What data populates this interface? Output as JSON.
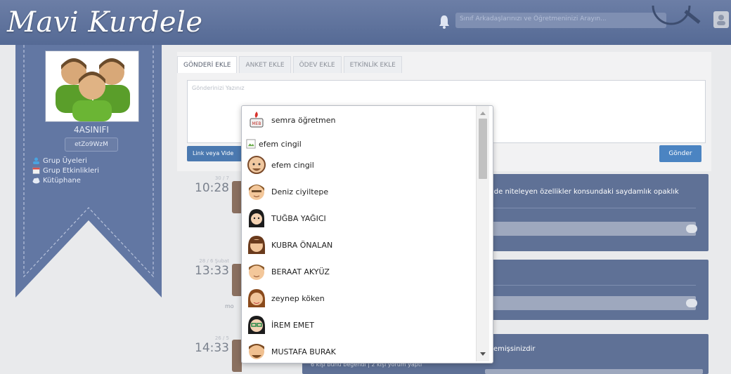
{
  "header": {
    "logo": "Mavi Kurdele",
    "search_placeholder": "Sınıf Arkadaşlarınızı ve Öğretmeninizi Arayın..."
  },
  "sidebar": {
    "group_name": "4ASINIFI",
    "group_code": "etZo9WzM",
    "menu": [
      {
        "label": "Grup Üyeleri",
        "icon": "users-icon"
      },
      {
        "label": "Grup Etkinlikleri",
        "icon": "calendar-icon"
      },
      {
        "label": "Kütüphane",
        "icon": "cloud-icon"
      }
    ]
  },
  "composer": {
    "tabs": [
      "GÖNDERİ EKLE",
      "ANKET EKLE",
      "ÖDEV EKLE",
      "ETKİNLİK EKLE"
    ],
    "placeholder": "Gönderinizi Yazınız",
    "link_button": "Link veya Vide",
    "send_button": "Gönder"
  },
  "feed": [
    {
      "date": "30 / 7",
      "time": "10:28",
      "text": "lde niteleyen özellikler konsundaki saydamlık opaklık"
    },
    {
      "date": "28 / 6 Şubat",
      "time": "13:33",
      "author_partial": "mo",
      "text": ""
    },
    {
      "date": "26 / 5",
      "time": "14:33",
      "text": "emişsinizdir",
      "meta": "6 kişi bunu beğendi | 2 kişi yorum yaptı"
    }
  ],
  "dropdown": {
    "items": [
      {
        "name": "semra öğretmen",
        "icon": "meb-logo-icon"
      },
      {
        "name": "efem cingil",
        "icon": "broken-image-icon"
      },
      {
        "name": "efem cingil",
        "icon": "bald-avatar-icon"
      },
      {
        "name": "Deniz ciyiltepe",
        "icon": "boy-avatar-icon"
      },
      {
        "name": "TUĞBA YAĞICI",
        "icon": "girl-avatar-icon"
      },
      {
        "name": "KUBRA ÖNALAN",
        "icon": "girl-avatar-icon"
      },
      {
        "name": "BERAAT AKYÜZ",
        "icon": "boy-avatar-icon"
      },
      {
        "name": "zeynep köken",
        "icon": "girl-avatar-icon"
      },
      {
        "name": "İREM EMET",
        "icon": "glasses-avatar-icon"
      },
      {
        "name": "MUSTAFA BURAK",
        "icon": "man-avatar-icon"
      }
    ]
  },
  "colors": {
    "header": "#5d6f99",
    "ribbon": "#6277a3",
    "send_button": "#4b84c2",
    "feed_card": "#5f7196"
  }
}
